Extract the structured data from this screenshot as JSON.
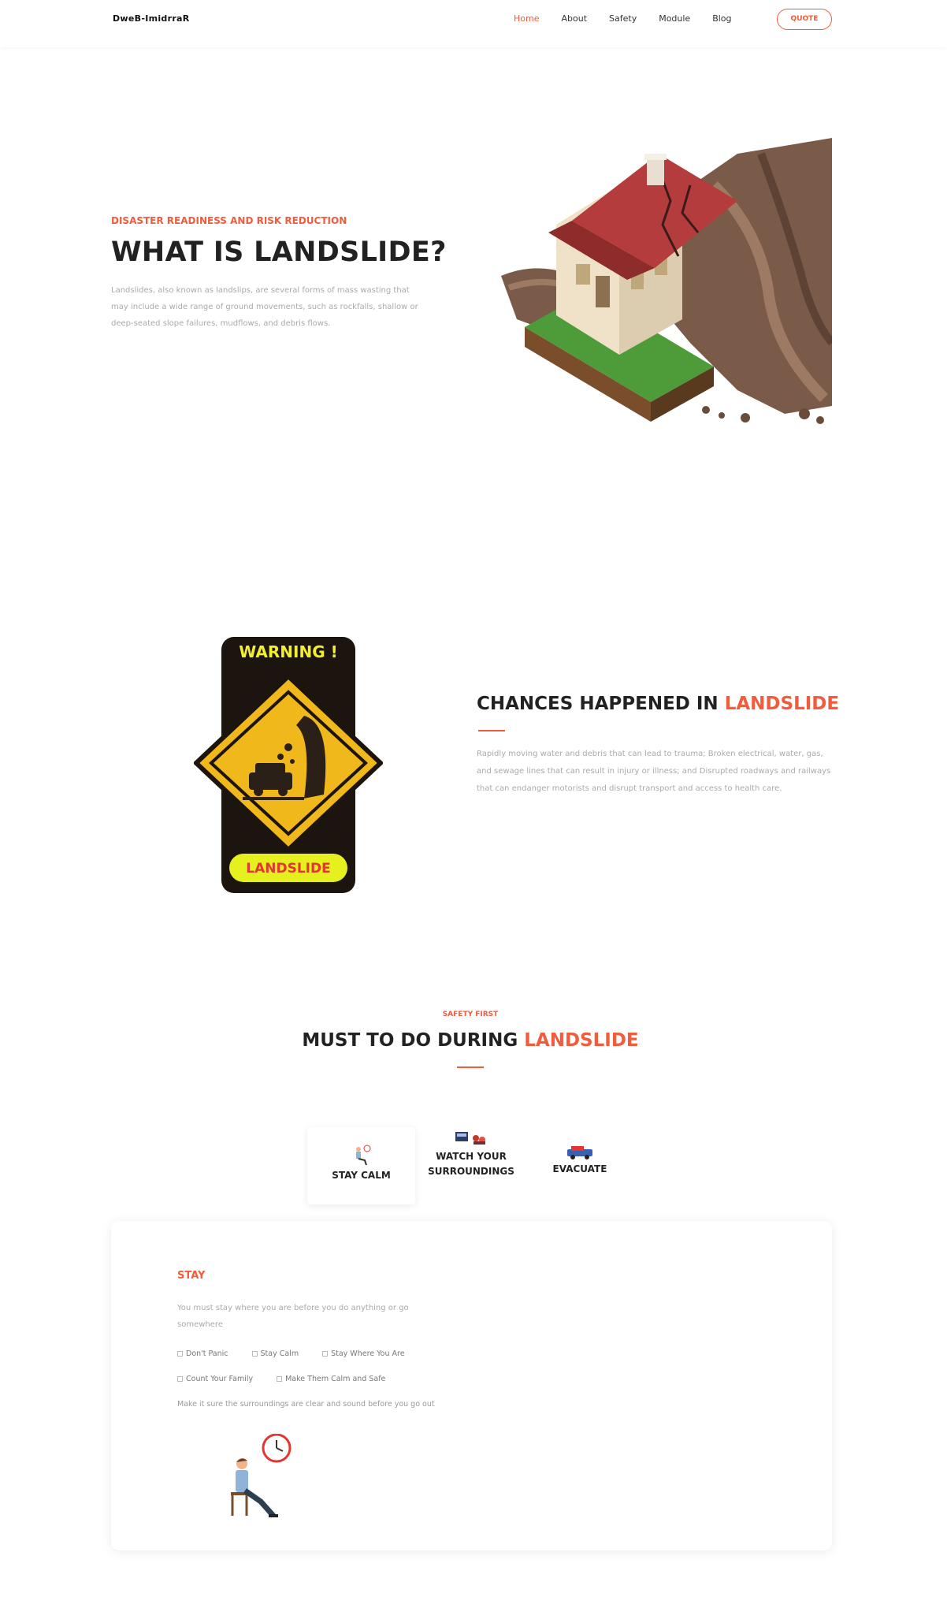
{
  "nav": {
    "brand": "DweB-ImidrraR",
    "links": [
      "Home",
      "About",
      "Safety",
      "Module",
      "Blog"
    ],
    "quote_label": "QUOTE"
  },
  "hero": {
    "eyebrow": "DISASTER READINESS AND RISK REDUCTION",
    "title": "WHAT IS LANDSLIDE?",
    "text": "Landslides, also known as landslips, are several forms of mass wasting that may include a wide range of ground movements, such as rockfalls, shallow or deep-seated slope failures, mudflows, and debris flows."
  },
  "warning_sign": {
    "top_text": "WARNING !",
    "bottom_text": "LANDSLIDE"
  },
  "chances": {
    "title_prefix": "CHANCES HAPPENED IN ",
    "title_accent": "LANDSLIDE",
    "text": "Rapidly moving water and debris that can lead to trauma; Broken electrical, water, gas, and sewage lines that can result in injury or illness; and Disrupted roadways and railways that can endanger motorists and disrupt transport and access to health care."
  },
  "safety": {
    "eyebrow": "SAFETY FIRST",
    "title_prefix": "MUST TO DO DURING ",
    "title_accent": "LANDSLIDE",
    "tabs": [
      {
        "label": "STAY CALM"
      },
      {
        "label_line1": "WATCH YOUR",
        "label_line2": "SURROUNDINGS"
      },
      {
        "label": "EVACUATE"
      }
    ],
    "card": {
      "heading": "STAY",
      "description": "You must stay where you are before you do anything or go somewhere",
      "checks_row1": [
        "Don't Panic",
        "Stay Calm",
        "Stay Where You Are"
      ],
      "checks_row2": [
        "Count Your Family",
        "Make Them Calm and Safe"
      ],
      "note": "Make it sure the surroundings are clear and sound before you go out"
    }
  },
  "colors": {
    "accent": "#f25c3c",
    "heading": "#222222",
    "muted": "#aaaaaa"
  }
}
